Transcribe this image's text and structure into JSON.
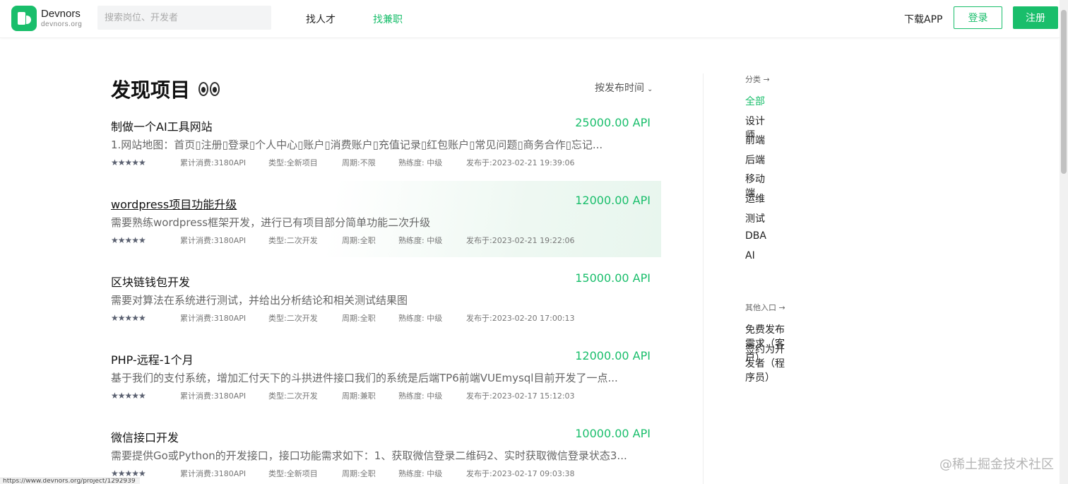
{
  "header": {
    "logo_name": "Devnors",
    "logo_domain": "devnors.org",
    "search_placeholder": "搜索岗位、开发者",
    "nav": [
      {
        "label": "找人才"
      },
      {
        "label": "找兼职"
      }
    ],
    "download_label": "下载APP",
    "login_label": "登录",
    "register_label": "注册"
  },
  "main": {
    "title": "发现项目",
    "sort_label": "按发布时间",
    "projects": [
      {
        "title": "制做一个AI工具网站",
        "price": "25000.00 API",
        "desc": "1.网站地图：首页▯注册▯登录▯个人中心▯账户▯消费账户▯充值记录▯红包账户▯常见问题▯商务合作▯忘记...",
        "stars": "★★★★★",
        "spent": "累计消费:3180API",
        "type": "类型:全新项目",
        "period": "周期:不限",
        "level": "熟练度: 中级",
        "date": "发布于:2023-02-21 19:39:06"
      },
      {
        "title": "wordpress项目功能升级",
        "price": "12000.00 API",
        "desc": "需要熟练wordpress框架开发，进行已有项目部分简单功能二次升级",
        "stars": "★★★★★",
        "spent": "累计消费:3180API",
        "type": "类型:二次开发",
        "period": "周期:全职",
        "level": "熟练度: 中级",
        "date": "发布于:2023-02-21 19:22:06"
      },
      {
        "title": "区块链钱包开发",
        "price": "15000.00 API",
        "desc": "需要对算法在系统进行测试，并给出分析结论和相关测试结果图",
        "stars": "★★★★★",
        "spent": "累计消费:3180API",
        "type": "类型:二次开发",
        "period": "周期:全职",
        "level": "熟练度: 中级",
        "date": "发布于:2023-02-20 17:00:13"
      },
      {
        "title": "PHP-远程-1个月",
        "price": "12000.00 API",
        "desc": "基于我们的支付系统，增加汇付天下的斗拱进件接口我们的系统是后端TP6前端VUEmysql目前开发了一点...",
        "stars": "★★★★★",
        "spent": "累计消费:3180API",
        "type": "类型:二次开发",
        "period": "周期:兼职",
        "level": "熟练度: 中级",
        "date": "发布于:2023-02-17 15:12:03"
      },
      {
        "title": "微信接口开发",
        "price": "10000.00 API",
        "desc": "需要提供Go或Python的开发接口，接口功能需求如下：1、获取微信登录二维码2、实时获取微信登录状态3...",
        "stars": "★★★★★",
        "spent": "累计消费:3180API",
        "type": "类型:全新项目",
        "period": "周期:全职",
        "level": "熟练度: 中级",
        "date": "发布于:2023-02-17 09:03:38"
      }
    ]
  },
  "sidebar": {
    "category_head": "分类 →",
    "categories": [
      "全部",
      "设计师",
      "前端",
      "后端",
      "移动端",
      "运维",
      "测试",
      "DBA",
      "AI"
    ],
    "other_head": "其他入口 →",
    "others": [
      "免费发布需求（客户）",
      "签约为开发者（程序员）"
    ]
  },
  "watermark": "@稀土掘金技术社区",
  "status_url": "https://www.devnors.org/project/1292939",
  "colors": {
    "accent": "#19be6b",
    "text": "#222222",
    "muted": "#666666"
  }
}
